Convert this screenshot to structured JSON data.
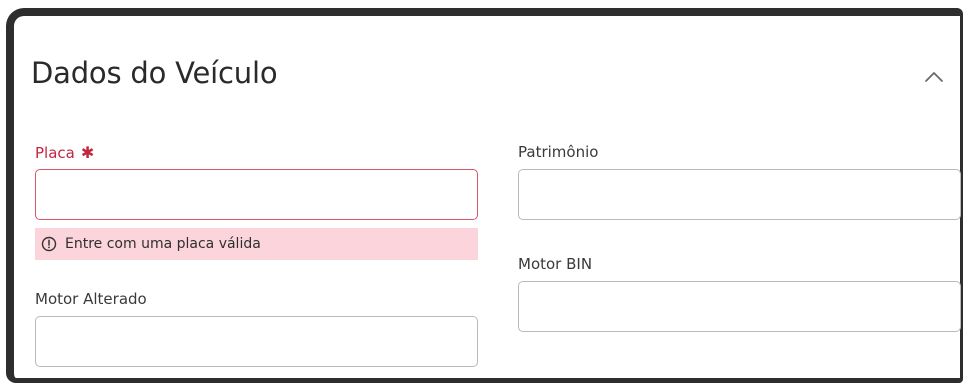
{
  "card": {
    "title": "Dados do Veículo"
  },
  "fields": {
    "placa": {
      "label": "Placa",
      "required_marker": "✱",
      "value": "",
      "error": "Entre com uma placa válida"
    },
    "motor_alterado": {
      "label": "Motor Alterado",
      "value": ""
    },
    "patrimonio": {
      "label": "Patrimônio",
      "value": ""
    },
    "motor_bin": {
      "label": "Motor BIN",
      "value": ""
    }
  },
  "icons": {
    "collapse": "chevron-up-icon",
    "error": "alert-circle-icon"
  },
  "colors": {
    "error_text": "#c2273f",
    "error_border": "#d8566a",
    "error_background": "#fbd5db"
  }
}
